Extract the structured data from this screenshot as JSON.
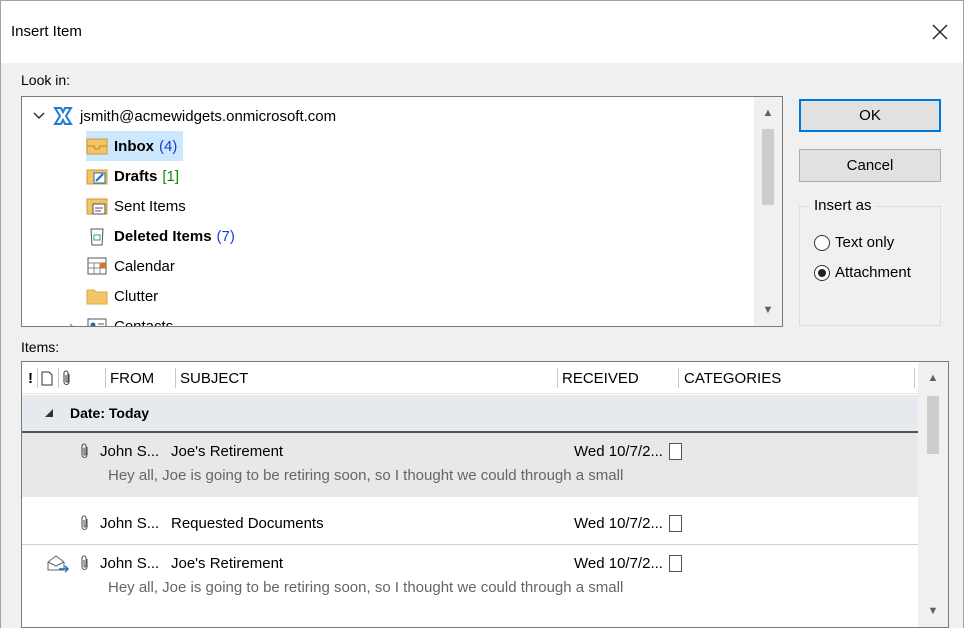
{
  "window": {
    "title": "Insert Item",
    "close_icon": "close-icon"
  },
  "look_in": {
    "label": "Look in:",
    "account": "jsmith@acmewidgets.onmicrosoft.com",
    "folders": [
      {
        "name": "Inbox",
        "count": "(4)",
        "icon": "inbox-icon",
        "bold": true,
        "selected": true
      },
      {
        "name": "Drafts",
        "count": "[1]",
        "icon": "drafts-icon",
        "bold": true
      },
      {
        "name": "Sent Items",
        "count": "",
        "icon": "sent-items-icon"
      },
      {
        "name": "Deleted Items",
        "count": "(7)",
        "icon": "trash-icon",
        "bold": true
      },
      {
        "name": "Calendar",
        "count": "",
        "icon": "calendar-icon"
      },
      {
        "name": "Clutter",
        "count": "",
        "icon": "folder-icon"
      },
      {
        "name": "Contacts",
        "count": "",
        "icon": "contacts-icon"
      }
    ]
  },
  "buttons": {
    "ok": "OK",
    "cancel": "Cancel"
  },
  "insert_as": {
    "title": "Insert as",
    "options": [
      {
        "label": "Text only",
        "selected": false
      },
      {
        "label": "Attachment",
        "selected": true
      }
    ]
  },
  "items": {
    "label": "Items:",
    "columns": {
      "importance": "!",
      "icon": "document-icon",
      "attachment": "paperclip-icon",
      "from": "FROM",
      "subject": "SUBJECT",
      "received": "RECEIVED",
      "categories": "CATEGORIES"
    },
    "group": "Date: Today",
    "rows": [
      {
        "from": "John S...",
        "subject": "Joe's Retirement",
        "received": "Wed 10/7/2...",
        "preview": "Hey all,   Joe is going to be retiring soon, so I thought we could through a small"
      },
      {
        "from": "John S...",
        "subject": "Requested Documents",
        "received": "Wed 10/7/2...",
        "preview": ""
      },
      {
        "from": "John S...",
        "subject": "Joe's Retirement",
        "received": "Wed 10/7/2...",
        "preview": "Hey all,   Joe is going to be retiring soon, so I thought we could through a small"
      }
    ]
  }
}
